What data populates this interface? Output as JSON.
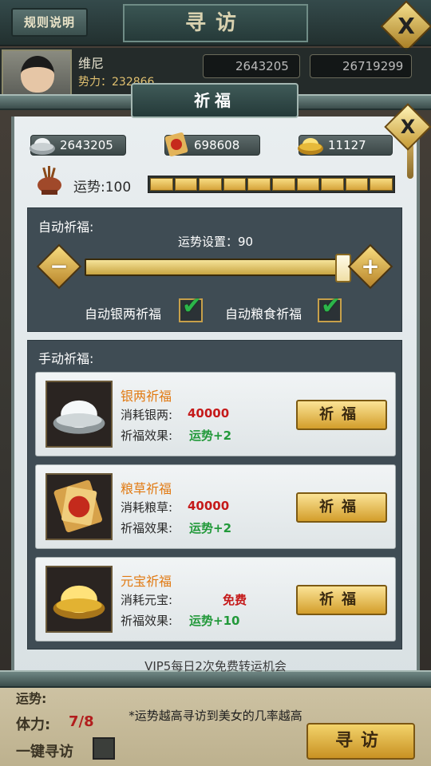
{
  "background": {
    "rules_button": "规则说明",
    "title": "寻访",
    "close": "X",
    "player": {
      "name": "维尼",
      "power": "势力：232866",
      "silver": "2643205",
      "food": "26719299"
    },
    "stamina_label": "体力:",
    "stamina_value": "7/8",
    "one_key_label": "一键寻访",
    "search_button": "寻访",
    "row0_label": "运势:"
  },
  "modal": {
    "title": "祈福",
    "close": "X",
    "resources": {
      "silver": "2643205",
      "grain": "698608",
      "gold": "11127"
    },
    "luck": {
      "label": "运势:100",
      "value": 100,
      "max": 100,
      "segments": 10
    },
    "auto": {
      "title": "自动祈福:",
      "setting": "运势设置：90",
      "setting_value": 90,
      "minus": "−",
      "plus": "+",
      "silver_label": "自动银两祈福",
      "grain_label": "自动粮食祈福",
      "silver_checked": true,
      "grain_checked": true
    },
    "manual": {
      "title": "手动祈福:",
      "cards": [
        {
          "name": "银两祈福",
          "cost_label": "消耗银两:",
          "cost": "40000",
          "effect_label": "祈福效果:",
          "effect": "运势+2",
          "button": "祈福",
          "icon": "silver-ingot-icon"
        },
        {
          "name": "粮草祈福",
          "cost_label": "消耗粮草:",
          "cost": "40000",
          "effect_label": "祈福效果:",
          "effect": "运势+2",
          "button": "祈福",
          "icon": "grain-token-icon"
        },
        {
          "name": "元宝祈福",
          "cost_label": "消耗元宝:",
          "cost": "免费",
          "effect_label": "祈福效果:",
          "effect": "运势+10",
          "button": "祈福",
          "icon": "gold-ingot-icon"
        }
      ]
    },
    "vip_note": "VIP5每日2次免费转运机会",
    "hint": "*运势越高寻访到美女的几率越高"
  },
  "colors": {
    "cost_red": "#c51a1a",
    "effect_green": "#22993a",
    "name_orange": "#e17a13",
    "gold": "#d5a33a"
  }
}
